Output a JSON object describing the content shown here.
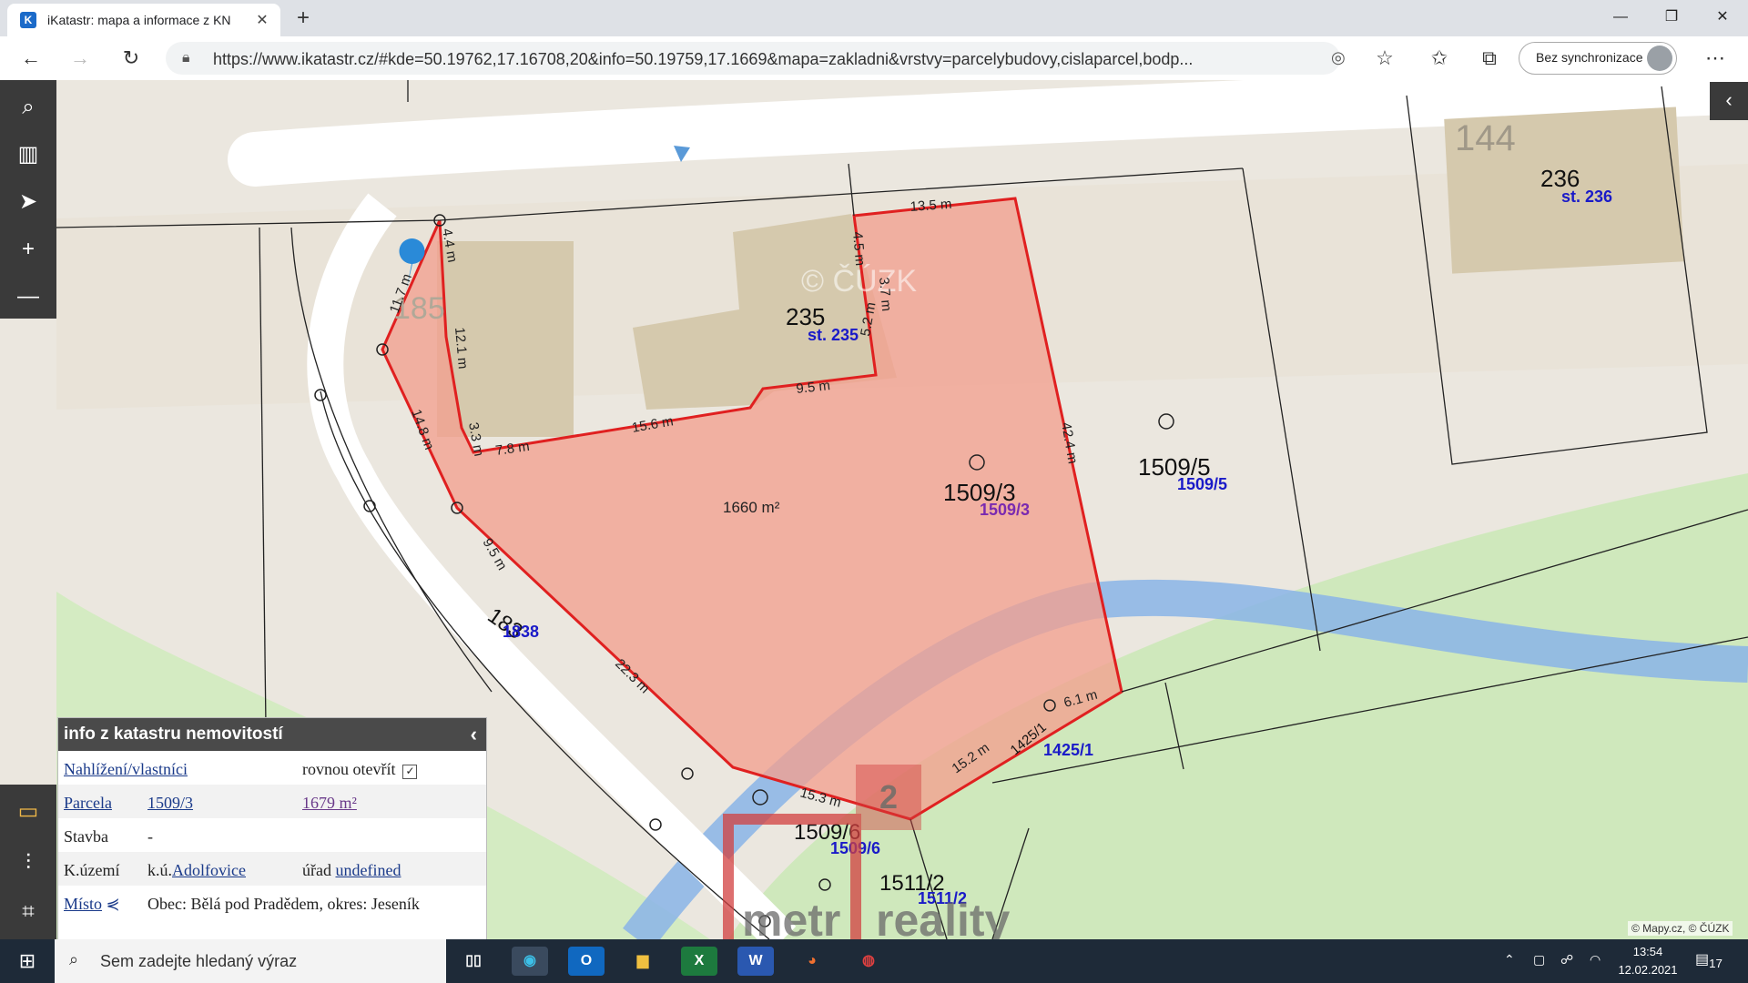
{
  "browser": {
    "tab_title": "iKatastr: mapa a informace z KN",
    "tab_favicon": "K",
    "url": "https://www.ikatastr.cz/#kde=50.19762,17.16708,20&info=50.19759,17.1669&mapa=zakladni&vrstvy=parcelybudovy,cislaparcel,bodp...",
    "sync_label": "Bez synchronizace",
    "close_icon": "✕",
    "new_tab_icon": "+"
  },
  "map": {
    "parcel_labels": {
      "p144": "144",
      "p236": "236",
      "st236": "st. 236",
      "p235": "235",
      "st235": "st. 235",
      "p185": "185",
      "p1509_3_black": "1509/3",
      "p1509_3_purple": "1509/3",
      "p1509_5_black": "1509/5",
      "p1509_5_blue": "1509/5",
      "area": "1660 m²",
      "p183": "183",
      "p1838": "1838",
      "p1509_6_black": "1509/6",
      "p1509_6_blue": "1509/6",
      "p1511_2_black": "1511/2",
      "p1511_2_blue": "1511/2",
      "p1425_1_black": "1425/1",
      "p1425_1_blue": "1425/1",
      "watermark_cuzk": "© ČÚZK",
      "logo_text_metr": "metr",
      "logo_text_reality": "reality",
      "logo_digit": "2"
    },
    "dimensions": {
      "d13_5": "13.5 m",
      "d4_4": "4.4 m",
      "d11_7": "11.7 m",
      "d12_1": "12.1 m",
      "d3_3": "3.3 m",
      "d7_8": "7.8 m",
      "d15_6": "15.6 m",
      "d9_5a": "9.5 m",
      "d4_5": "4.5 m",
      "d3_7": "3.7 m",
      "d5_2": "5.2 m",
      "d42_4": "42.4 m",
      "d14_8": "14.8 m",
      "d9_5b": "9.5 m",
      "d22_3": "22.3 m",
      "d15_3": "15.3 m",
      "d15_2": "15.2 m",
      "d6_1": "6.1 m"
    },
    "copyright": "© Mapy.cz, © ČÚZK",
    "colors": {
      "selected_fill": "#f2a090",
      "boundary": "#e02020",
      "road": "#ffffff",
      "building": "#d9ccb0",
      "grass": "#c8e6b0",
      "stream": "#8ab4e8",
      "label_blue": "#1a1ac8",
      "label_purple": "#7a2ab0"
    }
  },
  "panel": {
    "title": "info z katastru nemovitostí",
    "link_view": "Nahlížení/vlastníci",
    "open_direct": "rovnou otevřít",
    "parcel_label": "Parcela",
    "parcel_value": "1509/3",
    "parcel_area": "1679 m²",
    "building_label": "Stavba",
    "building_value": "-",
    "ku_label": "K.území",
    "ku_prefix": "k.ú.",
    "ku_value": "Adolfovice",
    "office_label": "úřad",
    "office_value": "undefined",
    "place_label": "Místo",
    "place_value": "Obec: Bělá pod Pradědem, okres: Jeseník"
  },
  "taskbar": {
    "search_placeholder": "Sem zadejte hledaný výraz",
    "time": "13:54",
    "date": "12.02.2021",
    "notifications": "17",
    "app_outlook": "O",
    "app_excel": "X",
    "app_word": "W"
  }
}
